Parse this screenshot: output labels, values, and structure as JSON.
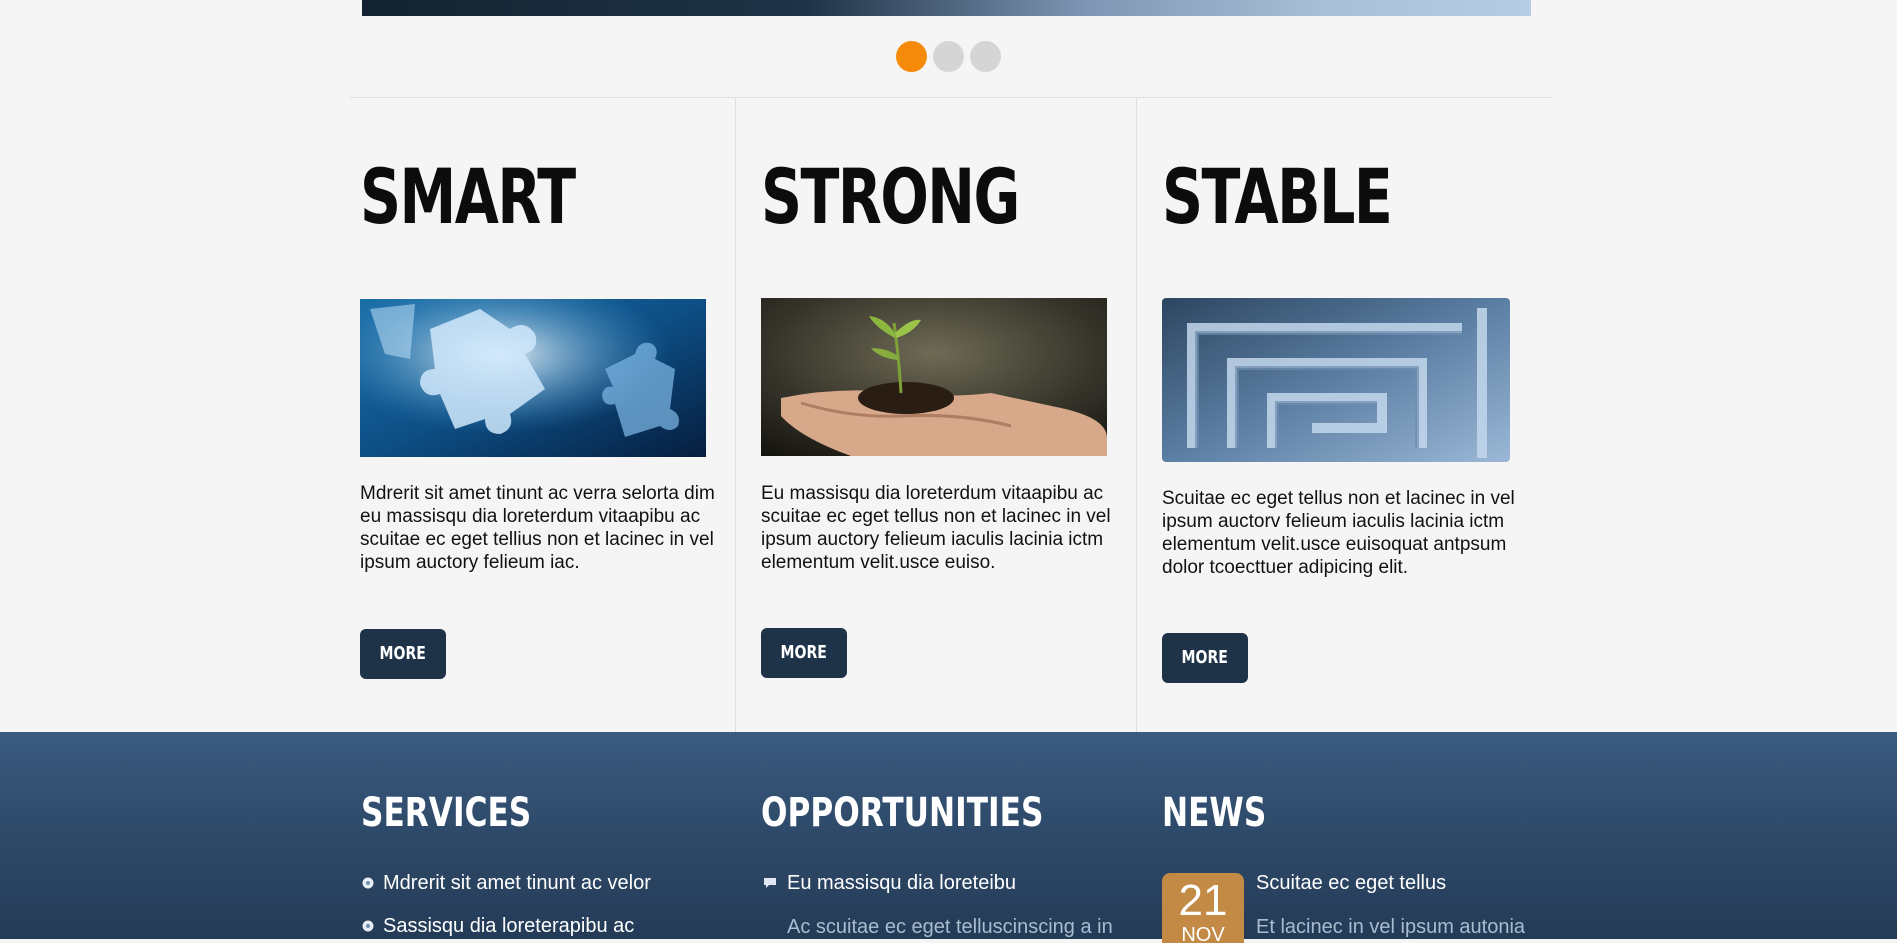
{
  "slider": {
    "dots_count": 3,
    "active_index": 0
  },
  "features": [
    {
      "title": "SMART",
      "text": "Mdrerit sit amet tinunt ac verra selorta dim eu massisqu dia loreterdum vitaapibu ac scuitae ec eget tellius non et lacinec in vel ipsum auctory felieum iac.",
      "more": "MORE"
    },
    {
      "title": "STRONG",
      "text": "Eu massisqu dia loreterdum vitaapibu ac scuitae ec eget tellus non et lacinec in vel ipsum auctory felieum iaculis lacinia ictm elementum velit.usce euiso.",
      "more": "MORE"
    },
    {
      "title": "STABLE",
      "text": "Scuitae ec eget tellus non et lacinec in vel ipsum auctorv felieum iaculis lacinia ictm elementum velit.usce euisoquat antpsum dolor tcoecttuer adipicing elit.",
      "more": "MORE"
    }
  ],
  "footer": {
    "services": {
      "title": "SERVICES",
      "items": [
        "Mdrerit sit amet tinunt ac velor",
        "Sassisqu dia loreterapibu ac"
      ]
    },
    "opportunities": {
      "title": "OPPORTUNITIES",
      "item": "Eu massisqu dia loreteibu",
      "sub": "Ac scuitae ec eget telluscinscing a in"
    },
    "news": {
      "title": "NEWS",
      "day": "21",
      "month": "NOV",
      "headline": "Scuitae ec eget tellus",
      "sub": "Et lacinec in vel ipsum autonia"
    }
  },
  "colors": {
    "accent_orange": "#f58a0b",
    "button_navy": "#1f3348",
    "footer_blue": "#34557a",
    "date_badge": "#c38a45"
  }
}
